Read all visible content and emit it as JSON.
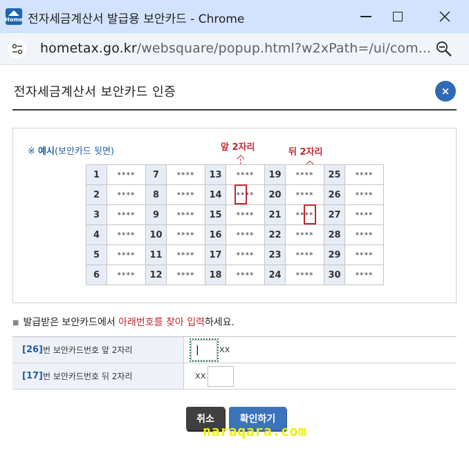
{
  "window": {
    "title": "전자세금계산서 발급용 보안카드 - Chrome",
    "app_icon_text": "Home"
  },
  "address_bar": {
    "domain": "hometax.go.kr",
    "path": "/websquare/popup.html?w2xPath=/ui/com..."
  },
  "popup": {
    "title": "전자세금계산서 보안카드 인증",
    "close_label": "×"
  },
  "example": {
    "note_prefix": "※ ",
    "note_bold": "예시",
    "note_rest": "(보안카드 뒷면)",
    "front_label": "앞 2자리",
    "back_label": "뒤 2자리",
    "mask": "****",
    "rows": [
      [
        "1",
        "7",
        "13",
        "19",
        "25"
      ],
      [
        "2",
        "8",
        "14",
        "20",
        "26"
      ],
      [
        "3",
        "9",
        "15",
        "21",
        "27"
      ],
      [
        "4",
        "10",
        "16",
        "22",
        "28"
      ],
      [
        "5",
        "11",
        "17",
        "23",
        "29"
      ],
      [
        "6",
        "12",
        "18",
        "24",
        "30"
      ]
    ]
  },
  "instruction": {
    "part1": "발급받은 보안카드에서 ",
    "part2_red": "아래번호를 찾아 입력",
    "part3": "하세요."
  },
  "inputs": [
    {
      "code": "[26]",
      "label": "번 보안카드번호 앞 2자리",
      "value": "|",
      "suffix": "xx"
    },
    {
      "code": "[17]",
      "label": "번 보안카드번호 뒤 2자리",
      "value": "",
      "prefix": "xx"
    }
  ],
  "buttons": {
    "cancel": "취소",
    "confirm": "확인하기"
  },
  "watermark": "naraqara.com",
  "colors": {
    "accent_blue": "#2e6bb4",
    "highlight_red": "#c0272d",
    "titlebar": "#d3e3fd"
  }
}
